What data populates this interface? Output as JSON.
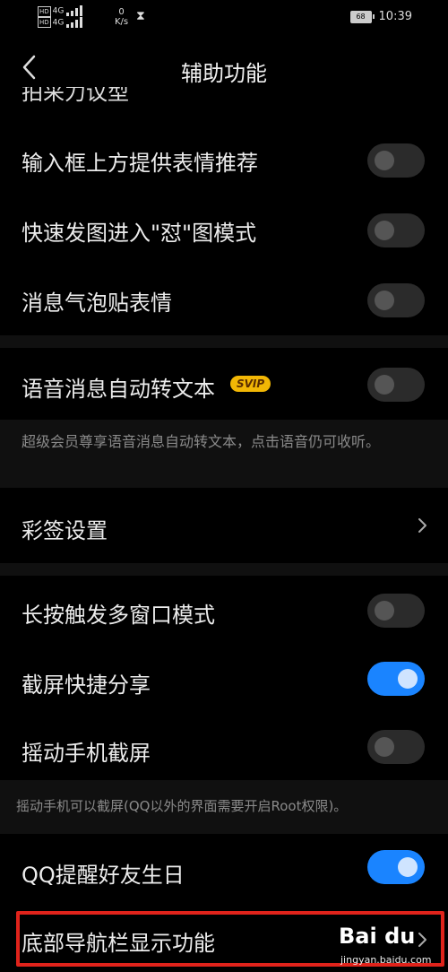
{
  "status": {
    "sim1_badge": "HD",
    "sim2_badge": "HD",
    "net1": "4G",
    "net2": "4G",
    "speed_value": "0",
    "speed_unit": "K/s",
    "battery": "68",
    "time": "10:39"
  },
  "header": {
    "title": "辅助功能"
  },
  "partial_label": "拍采力议型",
  "rows": [
    {
      "label": "输入框上方提供表情推荐",
      "toggle": "off"
    },
    {
      "label": "快速发图进入\"怼\"图模式",
      "toggle": "off"
    },
    {
      "label": "消息气泡贴表情",
      "toggle": "off"
    },
    {
      "label": "语音消息自动转文本",
      "badge": "SVIP",
      "toggle": "off"
    },
    {
      "label": "彩签设置"
    },
    {
      "label": "长按触发多窗口模式",
      "toggle": "off"
    },
    {
      "label": "截屏快捷分享",
      "toggle": "on"
    },
    {
      "label": "摇动手机截屏",
      "toggle": "off"
    },
    {
      "label": "QQ提醒好友生日",
      "toggle": "on"
    },
    {
      "label": "底部导航栏显示功能"
    }
  ],
  "notes": {
    "svip_note": "超级会员尊享语音消息自动转文本，点击语音仍可收听。",
    "shake_note": "摇动手机可以截屏(QQ以外的界面需要开启Root权限)。"
  },
  "watermark": {
    "logo": "Bai du",
    "url": "jingyan.baidu.com"
  },
  "colors": {
    "accent": "#1a84ff",
    "highlight": "#e0231b",
    "svip_badge": "#f2b705"
  }
}
